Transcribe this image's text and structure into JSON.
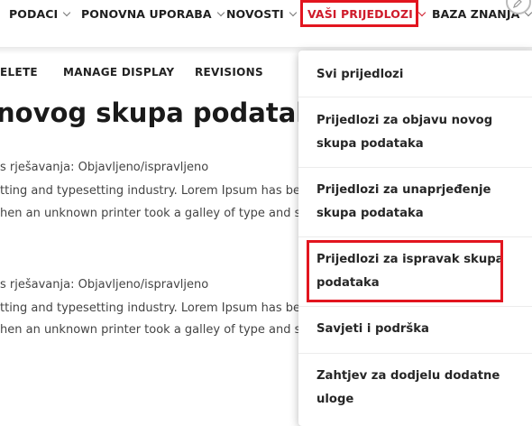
{
  "nav": {
    "items": [
      {
        "label": "PODACI"
      },
      {
        "label": "PONOVNA UPORABA"
      },
      {
        "label": "NOVOSTI"
      },
      {
        "label": "VAŠI PRIJEDLOZI",
        "active": true
      },
      {
        "label": "BAZA ZNANJA"
      }
    ]
  },
  "tabs": [
    "ELETE",
    "MANAGE DISPLAY",
    "REVISIONS"
  ],
  "page": {
    "title": "novog skupa podataka",
    "lines": [
      "s rješavanja: Objavljeno/ispravljeno",
      "tting and typesetting industry. Lorem Ipsum has bee",
      "hen an unknown printer took a galley of type and sc",
      "s rješavanja: Objavljeno/ispravljeno",
      "tting and typesetting industry. Lorem Ipsum has bee",
      "hen an unknown printer took a galley of type and sc"
    ]
  },
  "dropdown": {
    "items": [
      {
        "label": "Svi prijedlozi"
      },
      {
        "label": "Prijedlozi za objavu novog skupa podataka"
      },
      {
        "label": "Prijedlozi za unaprjeđenje skupa podataka"
      },
      {
        "label": "Prijedlozi za ispravak skupa podataka",
        "highlighted": true
      },
      {
        "label": "Savjeti i podrška"
      },
      {
        "label": "Zahtjev za dodjelu dodatne uloge"
      }
    ]
  },
  "colors": {
    "accent": "#cf1b2b",
    "highlight_box": "#e2151f"
  }
}
